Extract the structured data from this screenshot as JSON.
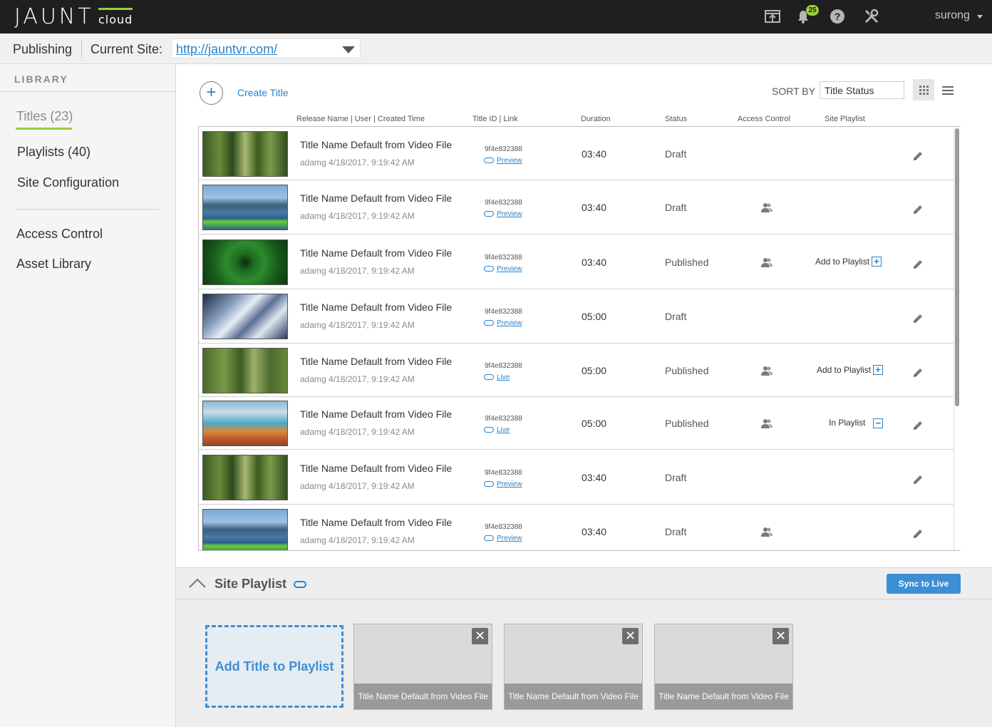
{
  "header": {
    "logo_text": "JAUNT",
    "logo_sub": "cloud",
    "notifications_count": "25",
    "username": "surong",
    "icons": [
      "upload-icon",
      "bell-icon",
      "help-icon",
      "tools-icon"
    ]
  },
  "subbar": {
    "section": "Publishing",
    "current_site_label": "Current Site:",
    "current_site_value": "http://jauntvr.com/"
  },
  "sidebar": {
    "heading": "LIBRARY",
    "items": [
      {
        "label": "Titles",
        "count": "(23)"
      },
      {
        "label": "Playlists (40)"
      },
      {
        "label": "Site Configuration"
      },
      {
        "label": "Access Control"
      },
      {
        "label": "Asset Library"
      }
    ]
  },
  "toolbar": {
    "create_label": "Create Title",
    "sort_by_label": "SORT BY",
    "sort_value": "Title Status"
  },
  "columns": [
    "Release Name  |  User  |  Created Time",
    "Title ID  |  Link",
    "Duration",
    "Status",
    "Access Control",
    "Site Playlist"
  ],
  "rows": [
    {
      "title": "Title Name Default from Video File",
      "meta": "adamg 4/18/2017, 9:19:42 AM",
      "id": "9f4e832388",
      "link": "Preview",
      "duration": "03:40",
      "status": "Draft",
      "access": false,
      "playlist": "",
      "thumb": "forest"
    },
    {
      "title": "Title Name Default from Video File",
      "meta": "adamg 4/18/2017, 9:19:42 AM",
      "id": "9f4e832388",
      "link": "Preview",
      "duration": "03:40",
      "status": "Draft",
      "access": true,
      "playlist": "",
      "thumb": "kayak"
    },
    {
      "title": "Title Name Default from Video File",
      "meta": "adamg 4/18/2017, 9:19:42 AM",
      "id": "9f4e832388",
      "link": "Preview",
      "duration": "03:40",
      "status": "Published",
      "access": true,
      "playlist": "Add to Playlist",
      "thumb": "plant"
    },
    {
      "title": "Title Name Default from Video File",
      "meta": "adamg 4/18/2017, 9:19:42 AM",
      "id": "9f4e832388",
      "link": "Preview",
      "duration": "05:00",
      "status": "Draft",
      "access": false,
      "playlist": "",
      "thumb": "geo"
    },
    {
      "title": "Title Name Default from Video File",
      "meta": "adamg 4/18/2017, 9:19:42 AM",
      "id": "9f4e832388",
      "link": "Live",
      "duration": "05:00",
      "status": "Published",
      "access": true,
      "playlist": "Add to Playlist",
      "thumb": "trees"
    },
    {
      "title": "Title Name Default from Video File",
      "meta": "adamg 4/18/2017, 9:19:42 AM",
      "id": "9f4e832388",
      "link": "Live",
      "duration": "05:00",
      "status": "Published",
      "access": true,
      "playlist": "In Playlist",
      "thumb": "spring"
    },
    {
      "title": "Title Name Default from Video File",
      "meta": "adamg 4/18/2017, 9:19:42 AM",
      "id": "9f4e832388",
      "link": "Preview",
      "duration": "03:40",
      "status": "Draft",
      "access": false,
      "playlist": "",
      "thumb": "forest"
    },
    {
      "title": "Title Name Default from Video File",
      "meta": "adamg 4/18/2017, 9:19:42 AM",
      "id": "9f4e832388",
      "link": "Preview",
      "duration": "03:40",
      "status": "Draft",
      "access": true,
      "playlist": "",
      "thumb": "kayak"
    }
  ],
  "site_playlist": {
    "title": "Site Playlist",
    "sync_label": "Sync to Live",
    "add_label": "Add Title to Playlist",
    "cards": [
      {
        "caption": "Title Name Default from Video File"
      },
      {
        "caption": "Title Name Default from Video File"
      },
      {
        "caption": "Title Name Default from Video File"
      }
    ]
  },
  "colors": {
    "accent": "#2b82c9",
    "brand_green": "#9ccc3c",
    "topbar": "#1f1f1f"
  }
}
